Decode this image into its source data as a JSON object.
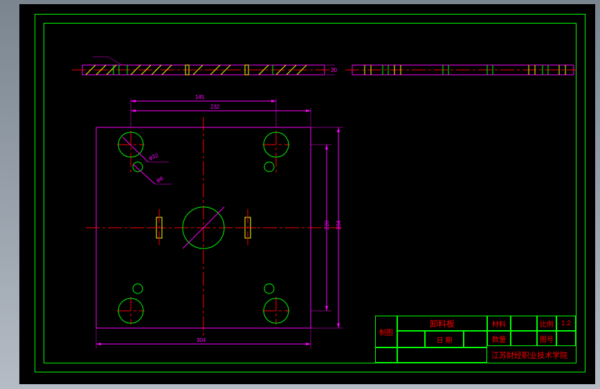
{
  "titleblock": {
    "part_name": "卸料板",
    "material_label": "材料",
    "material_value": "",
    "scale_label": "比例",
    "scale_value": "1:2",
    "quantity_label": "数量",
    "quantity_value": "",
    "drawing_no_label": "图号",
    "drawing_no_value": "",
    "date_label": "日 期",
    "date_value": "",
    "institution": "江苏财经职业技术学院",
    "draft_label": "制图"
  },
  "dimensions": {
    "overall_width_top": "232",
    "hole_spacing_top": "145",
    "hole_spacing_right": "220",
    "overall_height_right": "284",
    "overall_width_bottom": "304",
    "thickness": "20",
    "dia_large": "φ32",
    "dia_small": "φ8"
  },
  "colors": {
    "geometry": "#00ff00",
    "outline": "#ff00ff",
    "center": "#ff0000",
    "hatch": "#ffff00",
    "dimension": "#ff00ff"
  }
}
